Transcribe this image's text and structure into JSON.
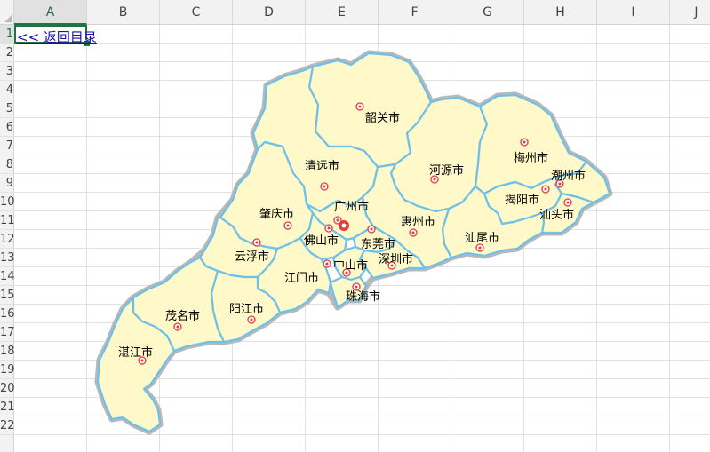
{
  "spreadsheet": {
    "columns": [
      "A",
      "B",
      "C",
      "D",
      "E",
      "F",
      "G",
      "H",
      "I",
      "J"
    ],
    "rows": [
      "1",
      "2",
      "3",
      "4",
      "5",
      "6",
      "7",
      "8",
      "9",
      "10",
      "11",
      "12",
      "13",
      "14",
      "15",
      "16",
      "17",
      "18",
      "19",
      "20",
      "21",
      "22"
    ],
    "active_column": "A",
    "active_row": "1"
  },
  "link": {
    "back_label": "<< 返回目录"
  },
  "map": {
    "cities": [
      {
        "id": "shaoguan",
        "name": "韶关市"
      },
      {
        "id": "qingyuan",
        "name": "清远市"
      },
      {
        "id": "heyuan",
        "name": "河源市"
      },
      {
        "id": "meizhou",
        "name": "梅州市"
      },
      {
        "id": "chaozhou",
        "name": "潮州市"
      },
      {
        "id": "jieyang",
        "name": "揭阳市"
      },
      {
        "id": "shantou",
        "name": "汕头市"
      },
      {
        "id": "shanwei",
        "name": "汕尾市"
      },
      {
        "id": "huizhou",
        "name": "惠州市"
      },
      {
        "id": "guangzhou",
        "name": "广州市"
      },
      {
        "id": "zhaoqing",
        "name": "肇庆市"
      },
      {
        "id": "foshan",
        "name": "佛山市"
      },
      {
        "id": "dongguan",
        "name": "东莞市"
      },
      {
        "id": "shenzhen",
        "name": "深圳市"
      },
      {
        "id": "yunfu",
        "name": "云浮市"
      },
      {
        "id": "jiangmen",
        "name": "江门市"
      },
      {
        "id": "zhongshan",
        "name": "中山市"
      },
      {
        "id": "zhuhai",
        "name": "珠海市"
      },
      {
        "id": "maoming",
        "name": "茂名市"
      },
      {
        "id": "yangjiang",
        "name": "阳江市"
      },
      {
        "id": "zhanjiang",
        "name": "湛江市"
      }
    ]
  },
  "colors": {
    "land": "#fff8c8",
    "border": "#6ec0e8",
    "outline": "#b8b8b8",
    "marker": "#e23c3c",
    "link": "#1a0dab",
    "excel_green": "#217346"
  }
}
